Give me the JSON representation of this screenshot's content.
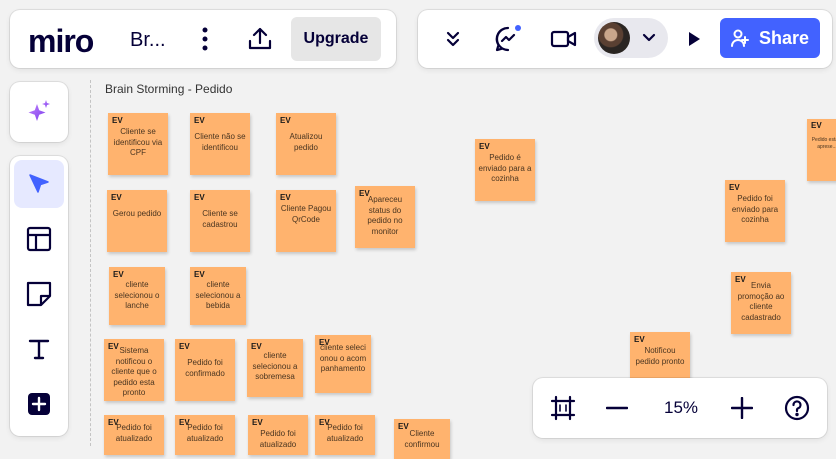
{
  "header": {
    "logo": "miro",
    "board_name": "Br...",
    "upgrade_label": "Upgrade",
    "share_label": "Share"
  },
  "canvas": {
    "frame_title": "Brain Storming - Pedido",
    "notes": [
      {
        "tag": "EV",
        "text": "Cliente se identificou via CPF"
      },
      {
        "tag": "EV",
        "text": "Cliente não se identificou"
      },
      {
        "tag": "EV",
        "text": "Atualizou pedido"
      },
      {
        "tag": "EV",
        "text": "Pedido é enviado para a cozinha"
      },
      {
        "tag": "EV",
        "text": "Pedido está... aprese..."
      },
      {
        "tag": "EV",
        "text": "Gerou pedido"
      },
      {
        "tag": "EV",
        "text": "Cliente se cadastrou"
      },
      {
        "tag": "EV",
        "text": "Cliente Pagou QrCode"
      },
      {
        "tag": "EV",
        "text": "Apareceu status do pedido no monitor"
      },
      {
        "tag": "EV",
        "text": "Pedido foi enviado para cozinha"
      },
      {
        "tag": "EV",
        "text": "cliente selecionou o lanche"
      },
      {
        "tag": "EV",
        "text": "cliente selecionou a bebida"
      },
      {
        "tag": "EV",
        "text": "Envia promoção ao cliente cadastrado"
      },
      {
        "tag": "EV",
        "text": "Sistema notificou o cliente que o pedido esta pronto"
      },
      {
        "tag": "EV",
        "text": "Pedido foi confirmado"
      },
      {
        "tag": "EV",
        "text": "cliente selecionou a sobremesa"
      },
      {
        "tag": "EV",
        "text": "cliente selecionou o acompanhamento"
      },
      {
        "tag": "EV",
        "text": "Notificou pedido pronto"
      },
      {
        "tag": "EV",
        "text": "Pedido foi atualizado"
      },
      {
        "tag": "EV",
        "text": "Pedido foi atualizado"
      },
      {
        "tag": "EV",
        "text": "Pedido foi atualizado"
      },
      {
        "tag": "EV",
        "text": "Pedido foi atualizado"
      },
      {
        "tag": "EV",
        "text": "Cliente confirmou"
      }
    ]
  },
  "zoom": {
    "level": "15%"
  },
  "colors": {
    "accent": "#4262ff",
    "sticky": "#ffb36e"
  }
}
